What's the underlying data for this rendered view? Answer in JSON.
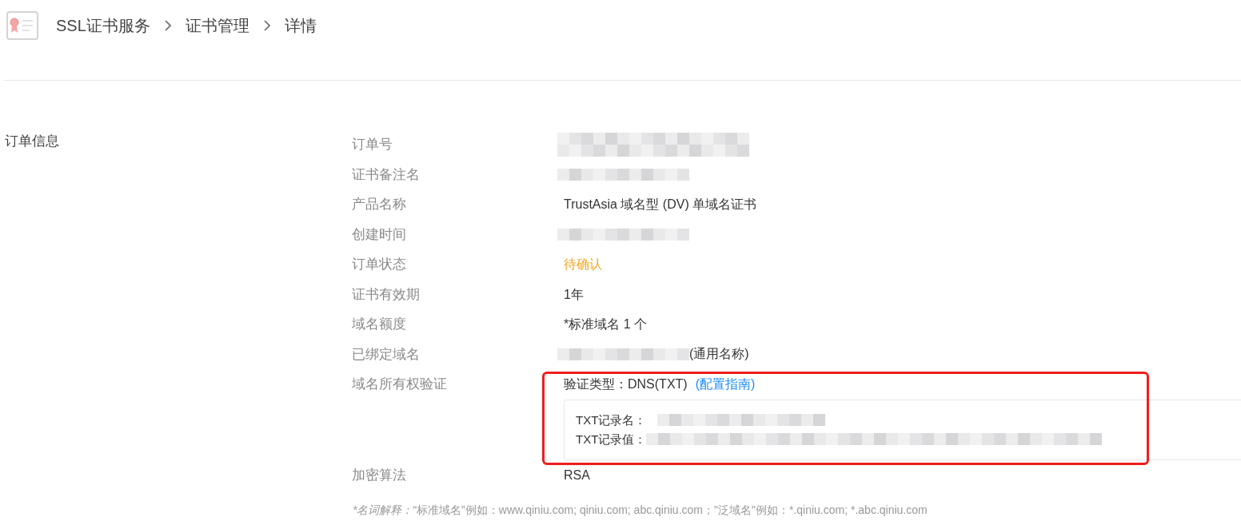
{
  "breadcrumb": [
    "SSL证书服务",
    "证书管理",
    "详情"
  ],
  "section": {
    "title": "订单信息",
    "fields": [
      {
        "label": "订单号",
        "kind": "redacted"
      },
      {
        "label": "证书备注名",
        "kind": "redacted"
      },
      {
        "label": "产品名称",
        "kind": "text",
        "value": "TrustAsia 域名型 (DV) 单域名证书"
      },
      {
        "label": "创建时间",
        "kind": "redacted"
      },
      {
        "label": "订单状态",
        "kind": "status",
        "value": "待确认"
      },
      {
        "label": "证书有效期",
        "kind": "text",
        "value": "1年"
      },
      {
        "label": "域名额度",
        "kind": "text",
        "value": "*标准域名 1 个"
      },
      {
        "label": "已绑定域名",
        "kind": "redacted_prefix",
        "value": "(通用名称)"
      },
      {
        "label": "域名所有权验证",
        "kind": "verification",
        "type_text": "验证类型：DNS(TXT)",
        "guide_link": "(配置指南)",
        "highlighted": true,
        "records": [
          {
            "label": "TXT记录名："
          },
          {
            "label": "TXT记录值："
          }
        ]
      },
      {
        "label": "加密算法",
        "kind": "text",
        "value": "RSA"
      }
    ]
  },
  "footnote": {
    "term": "*名词解释：",
    "text": "“标准域名”例如：www.qiniu.com; qiniu.com; abc.qiniu.com；\"泛域名\"例如：*.qiniu.com; *.abc.qiniu.com"
  }
}
